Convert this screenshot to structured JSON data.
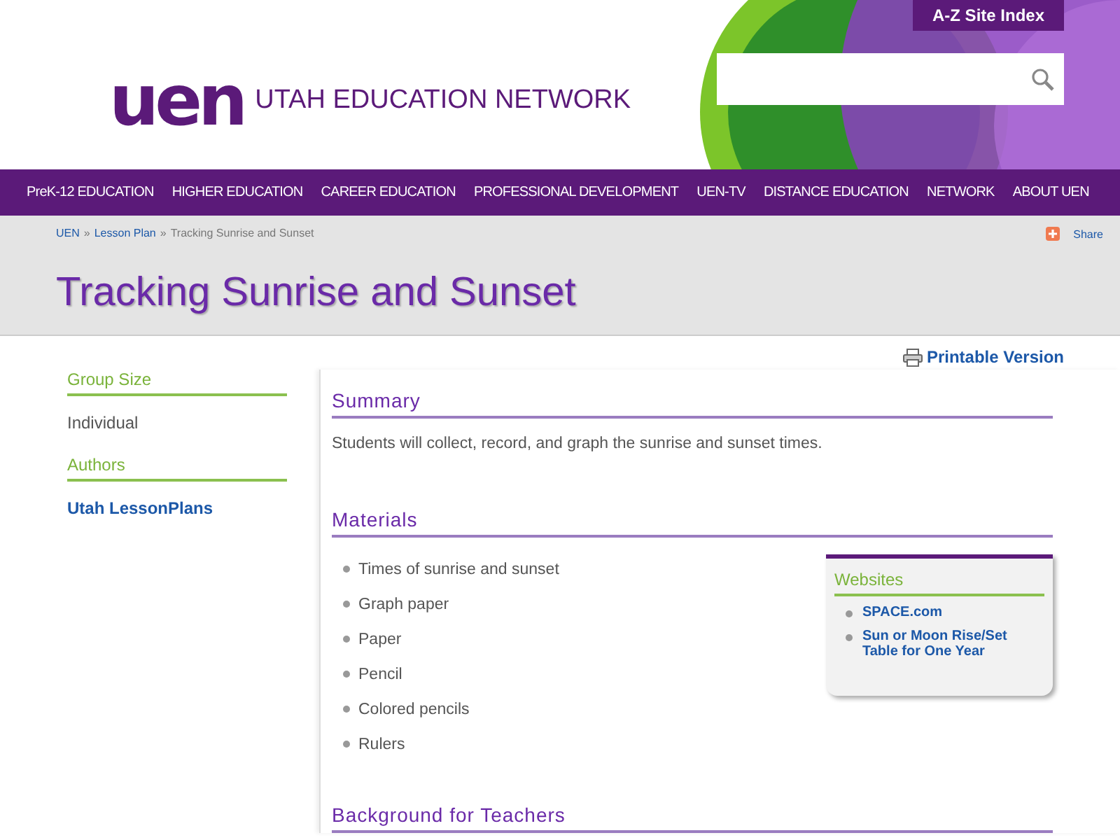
{
  "header": {
    "logo_mark": "uen",
    "site_name": "UTAH EDUCATION NETWORK",
    "site_index": "A-Z Site Index"
  },
  "nav": [
    "PreK-12 EDUCATION",
    "HIGHER EDUCATION",
    "CAREER EDUCATION",
    "PROFESSIONAL DEVELOPMENT",
    "UEN-TV",
    "DISTANCE EDUCATION",
    "NETWORK",
    "ABOUT UEN"
  ],
  "breadcrumb": {
    "links": [
      "UEN",
      "Lesson Plan"
    ],
    "separator": "»",
    "current": "Tracking Sunrise and Sunset"
  },
  "share": "Share",
  "page_title": "Tracking Sunrise and Sunset",
  "printable": "Printable Version",
  "sidebar": [
    {
      "heading": "Group Size",
      "value": "Individual",
      "kind": "text"
    },
    {
      "heading": "Authors",
      "value": "Utah LessonPlans",
      "kind": "link"
    }
  ],
  "summary": {
    "heading": "Summary",
    "text": "Students will collect, record, and graph the sunrise and sunset times."
  },
  "materials": {
    "heading": "Materials",
    "items": [
      "Times of sunrise and sunset",
      "Graph paper",
      "Paper",
      "Pencil",
      "Colored pencils",
      "Rulers"
    ]
  },
  "websites": {
    "heading": "Websites",
    "links": [
      "SPACE.com",
      "Sun or Moon Rise/Set Table for One Year"
    ]
  },
  "background": {
    "heading": "Background for Teachers"
  }
}
